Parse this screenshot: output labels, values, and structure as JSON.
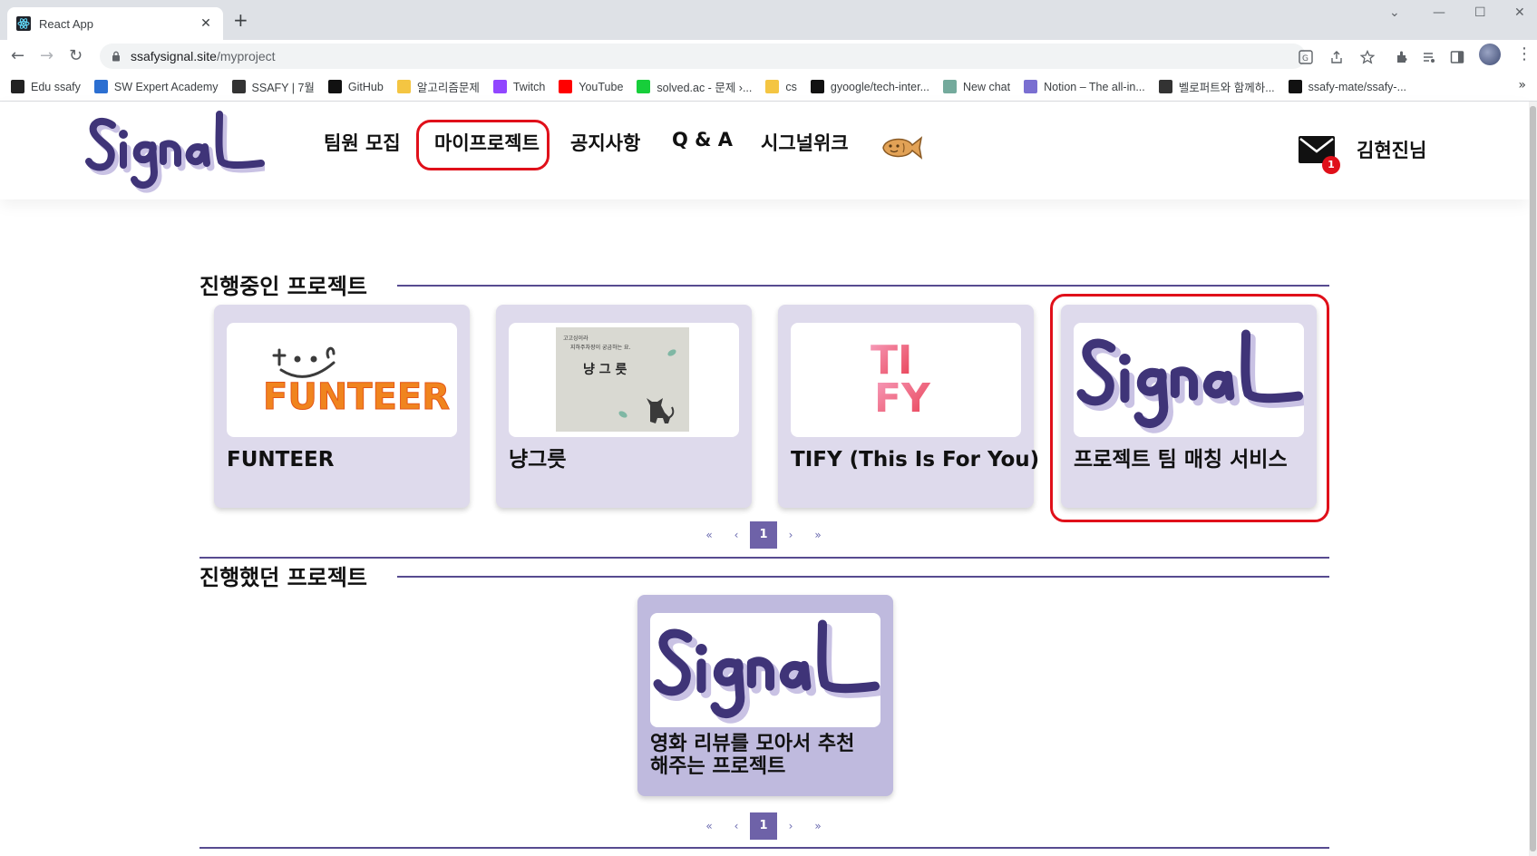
{
  "browser": {
    "tab_title": "React App",
    "tab_close": "✕",
    "new_tab": "+",
    "url_domain": "ssafysignal.site",
    "url_path": "/myproject",
    "bookmarks": [
      {
        "label": "Edu ssafy",
        "color": "#222222"
      },
      {
        "label": "SW Expert Academy",
        "color": "#2c6fd1"
      },
      {
        "label": "SSAFY | 7월",
        "color": "#333333"
      },
      {
        "label": "GitHub",
        "color": "#111111"
      },
      {
        "label": "알고리즘문제",
        "color": "#f4c542"
      },
      {
        "label": "Twitch",
        "color": "#9146ff"
      },
      {
        "label": "YouTube",
        "color": "#ff0000"
      },
      {
        "label": "solved.ac - 문제 ›...",
        "color": "#17ce3a"
      },
      {
        "label": "cs",
        "color": "#f4c542"
      },
      {
        "label": "gyoogle/tech-inter...",
        "color": "#111111"
      },
      {
        "label": "New chat",
        "color": "#74aa9c"
      },
      {
        "label": "Notion – The all-in...",
        "color": "#7a6fd1"
      },
      {
        "label": "벨로퍼트와 함께하...",
        "color": "#333333"
      },
      {
        "label": "ssafy-mate/ssafy-...",
        "color": "#111111"
      }
    ],
    "bookmarks_more": "»"
  },
  "header": {
    "logo_text": "Signal",
    "nav": [
      "팀원 모집",
      "마이프로젝트",
      "공지사항",
      "Q & A",
      "시그널위크"
    ],
    "mail_badge": "1",
    "user_name": "김현진님"
  },
  "ongoing": {
    "title": "진행중인 프로젝트",
    "cards": [
      {
        "title": "FUNTEER",
        "thumb_text": "FUNTEER"
      },
      {
        "title": "냥그릇",
        "thumb_text": "냥 그 릇",
        "thumb_caption_1": "고고싱이라",
        "thumb_caption_2": "지하주차장이 궁금하는 요."
      },
      {
        "title": "TIFY (This Is For You)",
        "thumb_text_1": "TI",
        "thumb_text_2": "FY"
      },
      {
        "title": "프로젝트 팀 매칭 서비스",
        "thumb_text": "Signal"
      }
    ],
    "pager": {
      "first": "«",
      "prev": "‹",
      "current": "1",
      "next": "›",
      "last": "»"
    }
  },
  "past": {
    "title": "진행했던 프로젝트",
    "cards": [
      {
        "title": "영화 리뷰를 모아서 추천해주는 프로젝트",
        "thumb_text": "Signal"
      }
    ],
    "pager": {
      "first": "«",
      "prev": "‹",
      "current": "1",
      "next": "›",
      "last": "»"
    }
  },
  "colors": {
    "accent": "#574b90",
    "card_bg": "#dedaec",
    "card_past_bg": "#bfbade",
    "highlight": "#e0101a",
    "pager_active": "#6e62a8"
  }
}
